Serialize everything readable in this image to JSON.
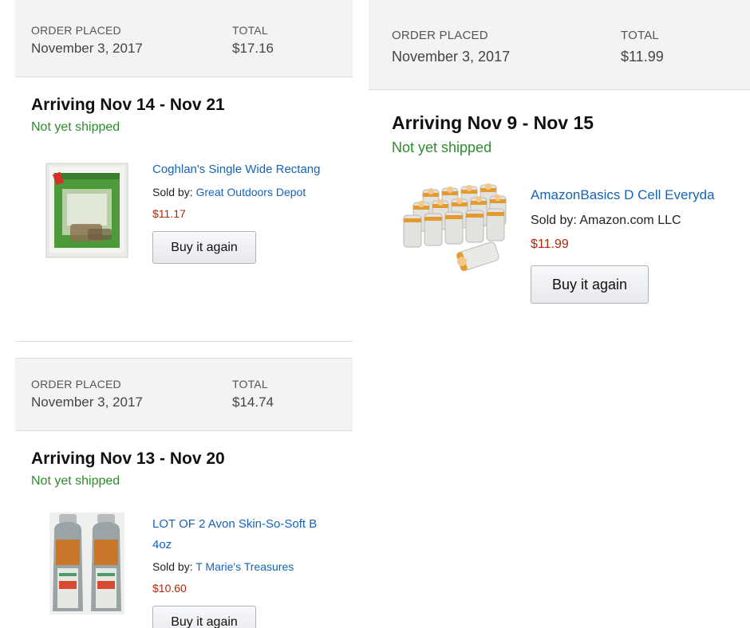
{
  "orders": [
    {
      "order_placed_label": "ORDER PLACED",
      "order_date": "November 3, 2017",
      "total_label": "TOTAL",
      "total": "$17.16",
      "arriving": "Arriving Nov 14 - Nov 21",
      "status": "Not yet shipped",
      "product_title": "Coghlan's Single Wide Rectang",
      "sold_by_label": "Sold by:",
      "seller": "Great Outdoors Depot",
      "price": "$11.17",
      "buy_again_label": "Buy it again",
      "image_icon": "mosquito-net-package"
    },
    {
      "order_placed_label": "ORDER PLACED",
      "order_date": "November 3, 2017",
      "total_label": "TOTAL",
      "total": "$14.74",
      "arriving": "Arriving Nov 13 - Nov 20",
      "status": "Not yet shipped",
      "product_title_line1": "LOT OF 2 Avon Skin-So-Soft B",
      "product_title_line2": "4oz",
      "sold_by_label": "Sold by:",
      "seller": "T Marie's Treasures",
      "price": "$10.60",
      "buy_again_label": "Buy it again",
      "image_icon": "two-lotion-bottles"
    },
    {
      "order_placed_label": "ORDER PLACED",
      "order_date": "November 3, 2017",
      "total_label": "TOTAL",
      "total": "$11.99",
      "arriving": "Arriving Nov 9 - Nov 15",
      "status": "Not yet shipped",
      "product_title": "AmazonBasics D Cell Everyda",
      "sold_by_label": "Sold by:",
      "seller": "Amazon.com LLC",
      "price": "$11.99",
      "buy_again_label": "Buy it again",
      "image_icon": "d-cell-batteries"
    }
  ],
  "colors": {
    "header_bg": "#f3f3f3",
    "link": "#1763b5",
    "price": "#b12704",
    "status_green": "#2d8d2d"
  }
}
